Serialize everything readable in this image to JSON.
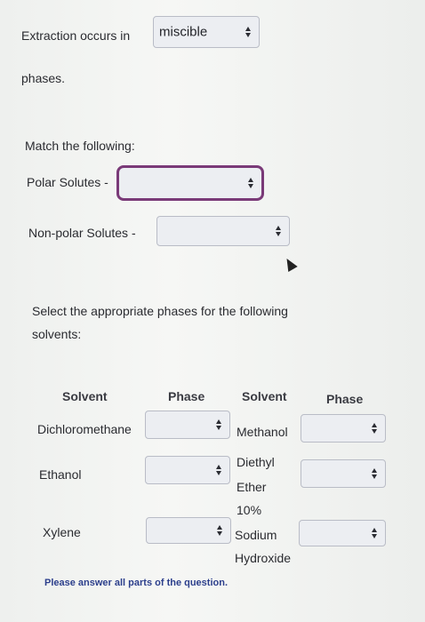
{
  "q1": {
    "prefix": "Extraction occurs in",
    "selected": "miscible",
    "suffix": "phases."
  },
  "q2": {
    "instruction": "Match the following:",
    "polar_label": "Polar Solutes -",
    "nonpolar_label": "Non-polar Solutes -",
    "polar_value": "",
    "nonpolar_value": ""
  },
  "q3": {
    "instruction_line1": "Select the appropriate phases for the following",
    "instruction_line2": "solvents:",
    "headers": [
      "Solvent",
      "Phase",
      "Solvent",
      "Phase"
    ],
    "left": [
      {
        "solvent": "Dichloromethane",
        "phase": ""
      },
      {
        "solvent": "Ethanol",
        "phase": ""
      },
      {
        "solvent": "Xylene",
        "phase": ""
      }
    ],
    "right": [
      {
        "solvent": "Methanol",
        "phase": ""
      },
      {
        "solvent_line1": "Diethyl",
        "solvent_line2": "Ether",
        "phase": ""
      },
      {
        "solvent_line1": "10%",
        "solvent_line2": "Sodium",
        "solvent_line3": "Hydroxide",
        "phase": ""
      }
    ]
  },
  "footer": {
    "note": "Please answer all parts of the question."
  },
  "colors": {
    "focus_border": "#7a3a78",
    "note_text": "#2c3f8c"
  },
  "icons": [
    "select-arrows-icon",
    "mouse-pointer-icon"
  ]
}
